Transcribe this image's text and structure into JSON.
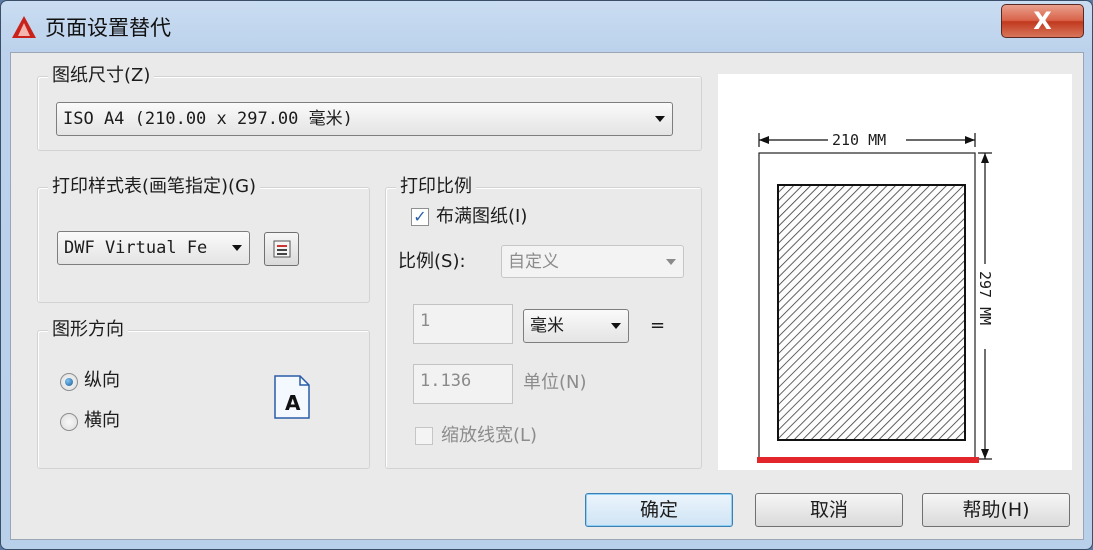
{
  "window": {
    "title": "页面设置替代",
    "close_glyph": "X",
    "app_icon": "autocad-logo-icon"
  },
  "paper_size": {
    "label": "图纸尺寸(Z)",
    "selected": "ISO A4 (210.00 x 297.00 毫米)"
  },
  "plot_style": {
    "label": "打印样式表(画笔指定)(G)",
    "selected": "DWF Virtual Fe",
    "edit_icon": "plot-style-edit-icon"
  },
  "orientation": {
    "label": "图形方向",
    "options": [
      {
        "label": "纵向",
        "selected": true
      },
      {
        "label": "横向",
        "selected": false
      }
    ],
    "preview_glyph": "A"
  },
  "plot_scale": {
    "label": "打印比例",
    "fit_to_paper": {
      "label": "布满图纸(I)",
      "checked": true
    },
    "scale_label": "比例(S):",
    "scale_value": "自定义",
    "value1": "1",
    "unit": "毫米",
    "equals": "=",
    "value2": "1.136",
    "unit_label": "单位(N)",
    "scale_lineweights": {
      "label": "缩放线宽(L)",
      "checked": false
    }
  },
  "preview": {
    "width_label": "210 MM",
    "height_label": "297 MM",
    "highlight_color": "#e3262b"
  },
  "buttons": {
    "ok": "确定",
    "cancel": "取消",
    "help": "帮助(H)"
  }
}
